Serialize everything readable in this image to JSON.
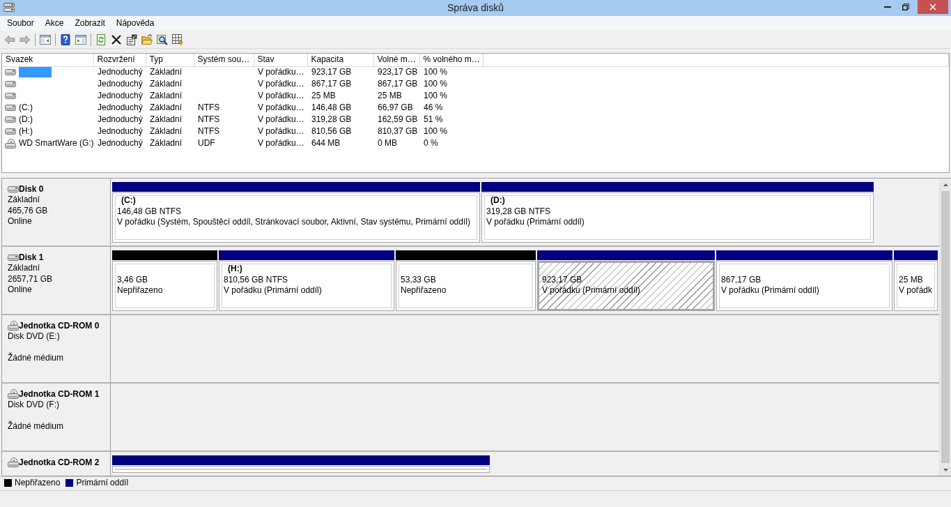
{
  "window": {
    "title": "Správa disků"
  },
  "menu": [
    "Soubor",
    "Akce",
    "Zobrazit",
    "Nápověda"
  ],
  "toolbar": [
    {
      "kind": "back",
      "disabled": true
    },
    {
      "kind": "forward",
      "disabled": true
    },
    {
      "kind": "separator"
    },
    {
      "kind": "console-tree",
      "disabled": false
    },
    {
      "kind": "separator"
    },
    {
      "kind": "help",
      "disabled": false
    },
    {
      "kind": "action-pane",
      "disabled": false
    },
    {
      "kind": "separator"
    },
    {
      "kind": "refresh",
      "disabled": false
    },
    {
      "kind": "delete",
      "disabled": false
    },
    {
      "kind": "properties",
      "disabled": false
    },
    {
      "kind": "open",
      "disabled": false
    },
    {
      "kind": "explore",
      "disabled": false
    },
    {
      "kind": "wizard",
      "disabled": false
    }
  ],
  "volumes": {
    "columns": [
      "Svazek",
      "Rozvržení",
      "Typ",
      "Systém sou…",
      "Stav",
      "Kapacita",
      "Volné m…",
      "% volného m…"
    ],
    "rows": [
      {
        "kind": "disk",
        "selected": true,
        "layout": "Jednoduchý",
        "type": "Základní",
        "status": "V pořádku…",
        "capacity": "923,17 GB",
        "free": "923,17 GB",
        "free_pct": "100 %"
      },
      {
        "kind": "disk",
        "selected": false,
        "layout": "Jednoduchý",
        "type": "Základní",
        "status": "V pořádku…",
        "capacity": "867,17 GB",
        "free": "867,17 GB",
        "free_pct": "100 %"
      },
      {
        "kind": "disk",
        "selected": false,
        "layout": "Jednoduchý",
        "type": "Základní",
        "status": "V pořádku…",
        "capacity": "25 MB",
        "free": "25 MB",
        "free_pct": "100 %"
      },
      {
        "kind": "disk",
        "selected": false,
        "name": "(C:)",
        "layout": "Jednoduchý",
        "type": "Základní",
        "fs": "NTFS",
        "status": "V pořádku…",
        "capacity": "146,48 GB",
        "free": "66,97 GB",
        "free_pct": "46 %"
      },
      {
        "kind": "disk",
        "selected": false,
        "name": "(D:)",
        "layout": "Jednoduchý",
        "type": "Základní",
        "fs": "NTFS",
        "status": "V pořádku…",
        "capacity": "319,28 GB",
        "free": "162,59 GB",
        "free_pct": "51 %"
      },
      {
        "kind": "disk",
        "selected": false,
        "name": "(H:)",
        "layout": "Jednoduchý",
        "type": "Základní",
        "fs": "NTFS",
        "status": "V pořádku…",
        "capacity": "810,56 GB",
        "free": "810,37 GB",
        "free_pct": "100 %"
      },
      {
        "kind": "optical",
        "selected": false,
        "name": "WD SmartWare (G:)",
        "layout": "Jednoduchý",
        "type": "Základní",
        "fs": "UDF",
        "status": "V pořádku…",
        "capacity": "644 MB",
        "free": "0 MB",
        "free_pct": "0 %"
      }
    ]
  },
  "disks": [
    {
      "kind": "disk",
      "name": "Disk 0",
      "type": "Základní",
      "size": "465,76 GB",
      "status": "Online",
      "partitions": [
        {
          "color": "#000080",
          "label": "(C:)",
          "size": "146,48 GB NTFS",
          "status": "V pořádku (Systém, Spouštěcí oddíl, Stránkovací soubor, Aktivní, Stav systému, Primární oddíl)",
          "selected": false
        },
        {
          "color": "#000080",
          "label": "(D:)",
          "size": "319,28 GB NTFS",
          "status": "V pořádku (Primární oddíl)",
          "selected": false
        }
      ]
    },
    {
      "kind": "disk",
      "name": "Disk 1",
      "type": "Základní",
      "size": "2657,71 GB",
      "status": "Online",
      "partitions": [
        {
          "color": "#000000",
          "size": "3,46 GB",
          "status": "Nepřiřazeno",
          "selected": false
        },
        {
          "color": "#000080",
          "label": "(H:)",
          "size": "810,56 GB NTFS",
          "status": "V pořádku (Primární oddíl)",
          "selected": false
        },
        {
          "color": "#000000",
          "size": "53,33 GB",
          "status": "Nepřiřazeno",
          "selected": false
        },
        {
          "color": "#000080",
          "size": "923,17 GB",
          "status": "V pořádku (Primární oddíl)",
          "selected": true
        },
        {
          "color": "#000080",
          "size": "867,17 GB",
          "status": "V pořádku (Primární oddíl)",
          "selected": false
        },
        {
          "color": "#000080",
          "size": "25 MB",
          "status": "V pořádk",
          "selected": false
        }
      ]
    },
    {
      "kind": "optical",
      "name": "Jednotka CD-ROM 0",
      "drive": "Disk DVD (E:)",
      "status": "Žádné médium"
    },
    {
      "kind": "optical",
      "name": "Jednotka CD-ROM 1",
      "drive": "Disk DVD (F:)",
      "status": "Žádné médium"
    },
    {
      "kind": "optical",
      "name": "Jednotka CD-ROM 2",
      "partitions": [
        {
          "color": "#000080",
          "selected": false
        }
      ]
    }
  ],
  "legend": [
    {
      "label": "Nepřiřazeno",
      "color": "#000000"
    },
    {
      "label": "Primární oddíl",
      "color": "#000080"
    }
  ]
}
